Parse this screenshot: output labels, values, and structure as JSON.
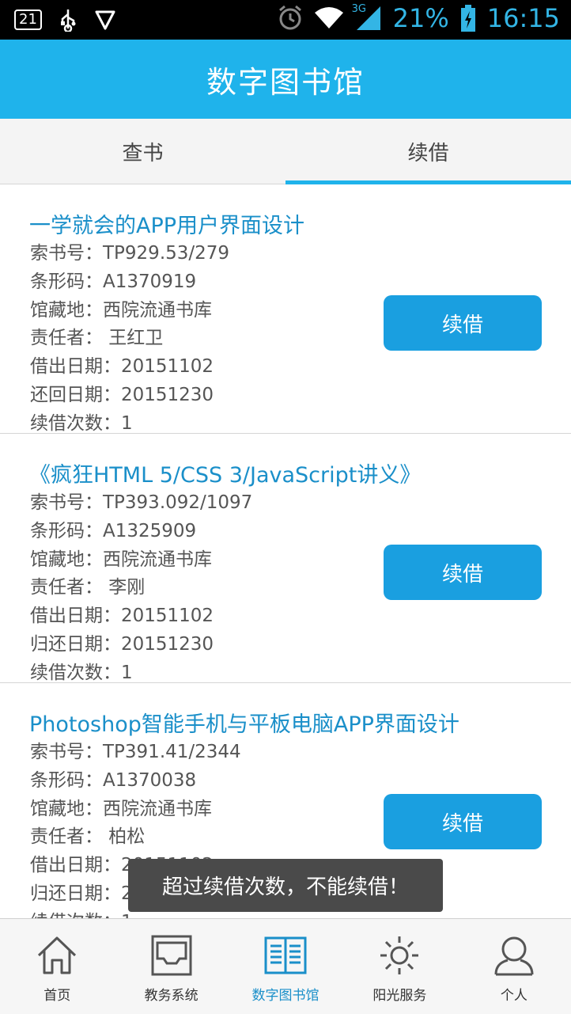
{
  "statusbar": {
    "notification_badge": "21",
    "battery_percent": "21%",
    "time": "16:15",
    "network": "3G",
    "icons": [
      "notification-icon",
      "usb-icon",
      "shield-icon",
      "alarm-icon",
      "wifi-icon",
      "signal-icon",
      "battery-icon"
    ]
  },
  "header": {
    "title": "数字图书馆"
  },
  "tabs": [
    {
      "label": "查书",
      "active": false
    },
    {
      "label": "续借",
      "active": true
    }
  ],
  "books": [
    {
      "title": "一学就会的APP用户界面设计",
      "fields": [
        "索书号：TP929.53/279",
        "条形码：A1370919",
        "馆藏地：西院流通书库",
        "责任者： 王红卫",
        "借出日期：20151102",
        "还回日期：20151230",
        "续借次数：1"
      ],
      "button": "续借"
    },
    {
      "title": "《疯狂HTML 5/CSS 3/JavaScript讲义》",
      "fields": [
        "索书号：TP393.092/1097",
        "条形码：A1325909",
        "馆藏地：西院流通书库",
        "责任者： 李刚",
        "借出日期：20151102",
        "归还日期：20151230",
        "续借次数：1"
      ],
      "button": "续借"
    },
    {
      "title": "Photoshop智能手机与平板电脑APP界面设计",
      "fields": [
        "索书号：TP391.41/2344",
        "条形码：A1370038",
        "馆藏地：西院流通书库",
        "责任者： 柏松",
        "借出日期：20151102",
        "归还日期：20151230",
        "续借次数：1"
      ],
      "button": "续借"
    }
  ],
  "toast": {
    "message": "超过续借次数，不能续借！"
  },
  "bottom_nav": [
    {
      "label": "首页",
      "icon": "home-icon",
      "active": false
    },
    {
      "label": "教务系统",
      "icon": "tray-icon",
      "active": false
    },
    {
      "label": "数字图书馆",
      "icon": "book-icon",
      "active": true
    },
    {
      "label": "阳光服务",
      "icon": "sun-icon",
      "active": false
    },
    {
      "label": "个人",
      "icon": "person-icon",
      "active": false
    }
  ],
  "colors": {
    "accent": "#1fb3eb",
    "button": "#1a9fe0",
    "title_text": "#1a8fc9",
    "status_text": "#33b5e5"
  }
}
